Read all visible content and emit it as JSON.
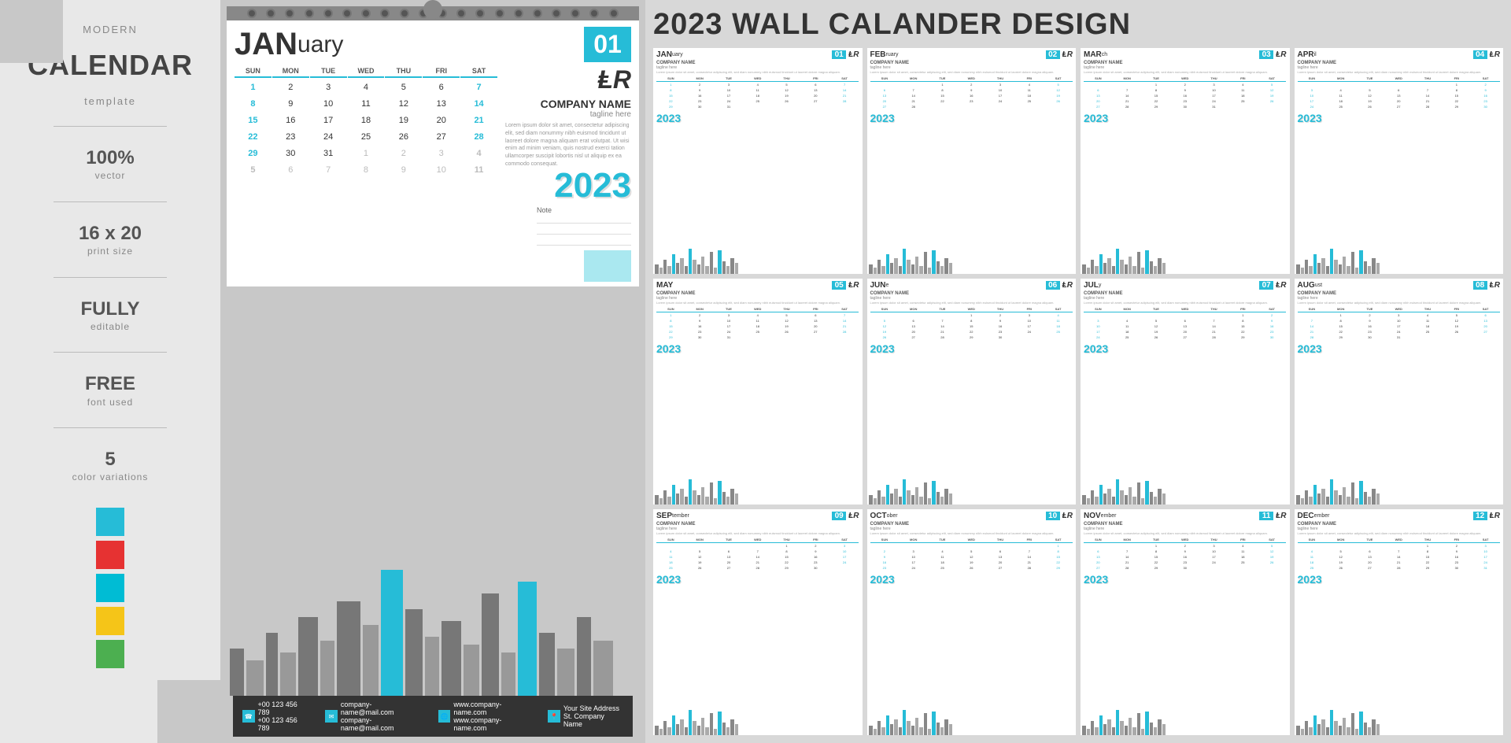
{
  "sidebar": {
    "title_small": "modern",
    "title_main": "CALENDAR",
    "title_sub": "template",
    "features": [
      {
        "main": "100%",
        "sub": "vector"
      },
      {
        "main": "16 x 20",
        "sub": "print size"
      },
      {
        "main": "FULLY",
        "sub": "editable"
      },
      {
        "main": "FREE",
        "sub": "font used"
      },
      {
        "main": "5",
        "sub": "color variations"
      }
    ],
    "colors": [
      "#26bcd7",
      "#e63232",
      "#00bcd4",
      "#f5c518",
      "#4caf50"
    ]
  },
  "calendar": {
    "month": "JAN",
    "month_rest": "uary",
    "num": "01",
    "days": [
      "SUN",
      "MON",
      "TUE",
      "WED",
      "THU",
      "FRI",
      "SAT"
    ],
    "year": "2023",
    "company_name": "COMPANY NAME",
    "tagline": "tagline here",
    "lorem": "Lorem ipsum dolor sit amet, consectetur adipiscing elit, sed diam nonummy nibh euismod tincidunt ut laoreet dolore magna aliquam erat volutpat. Ut wisi enim ad minim veniam, quis nostrud exerci tation ullamcorper suscipit lobortis nisl ut aliquip ex ea commodo consequat.",
    "note": "Note"
  },
  "wall_title": "2023 WALL CALANDER DESIGN",
  "months": [
    {
      "name": "JAN",
      "name_rest": "uary",
      "num": "01",
      "dates": [
        [
          1,
          2,
          3,
          4,
          5,
          6,
          7
        ],
        [
          8,
          9,
          10,
          11,
          12,
          13,
          14
        ],
        [
          15,
          16,
          17,
          18,
          19,
          20,
          21
        ],
        [
          22,
          23,
          24,
          25,
          26,
          27,
          28
        ],
        [
          29,
          30,
          31,
          0,
          0,
          0,
          0
        ]
      ]
    },
    {
      "name": "FEB",
      "name_rest": "ruary",
      "num": "02",
      "dates": [
        [
          0,
          0,
          1,
          2,
          3,
          4,
          5
        ],
        [
          6,
          7,
          8,
          9,
          10,
          11,
          12
        ],
        [
          13,
          14,
          15,
          16,
          17,
          18,
          19
        ],
        [
          20,
          21,
          22,
          23,
          24,
          25,
          26
        ],
        [
          27,
          28,
          0,
          0,
          0,
          0,
          0
        ]
      ]
    },
    {
      "name": "MAR",
      "name_rest": "ch",
      "num": "03",
      "dates": [
        [
          0,
          0,
          1,
          2,
          3,
          4,
          5
        ],
        [
          6,
          7,
          8,
          9,
          10,
          11,
          12
        ],
        [
          13,
          14,
          15,
          16,
          17,
          18,
          19
        ],
        [
          20,
          21,
          22,
          23,
          24,
          25,
          26
        ],
        [
          27,
          28,
          29,
          30,
          31,
          0,
          0
        ]
      ]
    },
    {
      "name": "APR",
      "name_rest": "il",
      "num": "04",
      "dates": [
        [
          0,
          0,
          0,
          0,
          0,
          1,
          2
        ],
        [
          3,
          4,
          5,
          6,
          7,
          8,
          9
        ],
        [
          10,
          11,
          12,
          13,
          14,
          15,
          16
        ],
        [
          17,
          18,
          19,
          20,
          21,
          22,
          23
        ],
        [
          24,
          25,
          26,
          27,
          28,
          29,
          30
        ]
      ]
    },
    {
      "name": "MAY",
      "name_rest": "",
      "num": "05",
      "dates": [
        [
          1,
          2,
          3,
          4,
          5,
          6,
          7
        ],
        [
          8,
          9,
          10,
          11,
          12,
          13,
          14
        ],
        [
          15,
          16,
          17,
          18,
          19,
          20,
          21
        ],
        [
          22,
          23,
          24,
          25,
          26,
          27,
          28
        ],
        [
          29,
          30,
          31,
          0,
          0,
          0,
          0
        ]
      ]
    },
    {
      "name": "JUN",
      "name_rest": "e",
      "num": "06",
      "dates": [
        [
          0,
          0,
          0,
          1,
          2,
          3,
          4
        ],
        [
          5,
          6,
          7,
          8,
          9,
          10,
          11
        ],
        [
          12,
          13,
          14,
          15,
          16,
          17,
          18
        ],
        [
          19,
          20,
          21,
          22,
          23,
          24,
          25
        ],
        [
          26,
          27,
          28,
          29,
          30,
          0,
          0
        ]
      ]
    },
    {
      "name": "JUL",
      "name_rest": "y",
      "num": "07",
      "dates": [
        [
          0,
          0,
          0,
          0,
          0,
          1,
          2
        ],
        [
          3,
          4,
          5,
          6,
          7,
          8,
          9
        ],
        [
          10,
          11,
          12,
          13,
          14,
          15,
          16
        ],
        [
          17,
          18,
          19,
          20,
          21,
          22,
          23
        ],
        [
          24,
          25,
          26,
          27,
          28,
          29,
          30
        ]
      ]
    },
    {
      "name": "AUG",
      "name_rest": "ust",
      "num": "08",
      "dates": [
        [
          0,
          1,
          2,
          3,
          4,
          5,
          6
        ],
        [
          7,
          8,
          9,
          10,
          11,
          12,
          13
        ],
        [
          14,
          15,
          16,
          17,
          18,
          19,
          20
        ],
        [
          21,
          22,
          23,
          24,
          25,
          26,
          27
        ],
        [
          28,
          29,
          30,
          31,
          0,
          0,
          0
        ]
      ]
    },
    {
      "name": "SEP",
      "name_rest": "tember",
      "num": "09",
      "dates": [
        [
          0,
          0,
          0,
          0,
          1,
          2,
          3
        ],
        [
          4,
          5,
          6,
          7,
          8,
          9,
          10
        ],
        [
          11,
          12,
          13,
          14,
          15,
          16,
          17
        ],
        [
          18,
          19,
          20,
          21,
          22,
          23,
          24
        ],
        [
          25,
          26,
          27,
          28,
          29,
          30,
          0
        ]
      ]
    },
    {
      "name": "OCT",
      "name_rest": "ober",
      "num": "10",
      "dates": [
        [
          0,
          0,
          0,
          0,
          0,
          0,
          1
        ],
        [
          2,
          3,
          4,
          5,
          6,
          7,
          8
        ],
        [
          9,
          10,
          11,
          12,
          13,
          14,
          15
        ],
        [
          16,
          17,
          18,
          19,
          20,
          21,
          22
        ],
        [
          23,
          24,
          25,
          26,
          27,
          28,
          29
        ]
      ]
    },
    {
      "name": "NOV",
      "name_rest": "ember",
      "num": "11",
      "dates": [
        [
          0,
          0,
          1,
          2,
          3,
          4,
          5
        ],
        [
          6,
          7,
          8,
          9,
          10,
          11,
          12
        ],
        [
          13,
          14,
          15,
          16,
          17,
          18,
          19
        ],
        [
          20,
          21,
          22,
          23,
          24,
          25,
          26
        ],
        [
          27,
          28,
          29,
          30,
          0,
          0,
          0
        ]
      ]
    },
    {
      "name": "DEC",
      "name_rest": "ember",
      "num": "12",
      "dates": [
        [
          0,
          0,
          0,
          0,
          1,
          2,
          3
        ],
        [
          4,
          5,
          6,
          7,
          8,
          9,
          10
        ],
        [
          11,
          12,
          13,
          14,
          15,
          16,
          17
        ],
        [
          18,
          19,
          20,
          21,
          22,
          23,
          24
        ],
        [
          25,
          26,
          27,
          28,
          29,
          30,
          31
        ]
      ]
    }
  ],
  "footer": {
    "phone1": "+00 123 456 789",
    "phone2": "+00 123 456 789",
    "email1": "company-name@mail.com",
    "email2": "company-name@mail.com",
    "web1": "www.company-name.com",
    "web2": "www.company-name.com",
    "address1": "Your Site Address",
    "address2": "St. Company Name"
  }
}
